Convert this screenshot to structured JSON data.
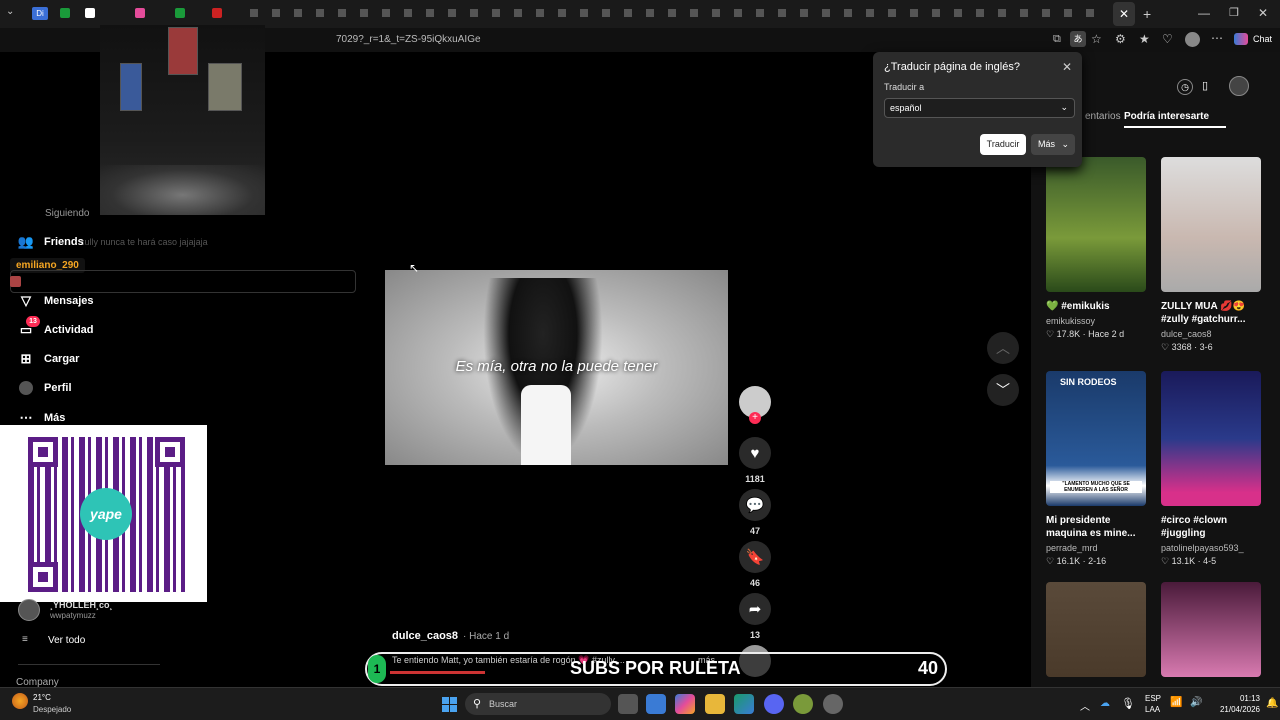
{
  "browser": {
    "url_fragment": "7029?_r=1&_t=ZS-95iQkxuAIGe",
    "chat_label": "Chat"
  },
  "translate_popup": {
    "title": "¿Traducir página de inglés?",
    "translate_to_label": "Traducir a",
    "language_value": "español",
    "translate_button": "Traducir",
    "more_button": "Más"
  },
  "overlay": {
    "chat_user": "emiliano_290",
    "chat_faded": "zully nunca te hará caso jajajaja",
    "following_faded": "Siguiendo",
    "subs_banner": "SUBS POR RULETA",
    "subs_count": "40",
    "subs_left_num": "1",
    "qr_brand": "yape"
  },
  "sidebar": {
    "items": [
      {
        "label": "Friends",
        "icon": "friends-icon"
      },
      {
        "label": "Mensajes",
        "icon": "messages-icon"
      },
      {
        "label": "Actividad",
        "icon": "activity-icon",
        "badge": "13"
      },
      {
        "label": "Cargar",
        "icon": "upload-icon"
      },
      {
        "label": "Perfil",
        "icon": "profile-icon"
      },
      {
        "label": "Más",
        "icon": "more-icon"
      }
    ],
    "following_user": "¸YHOLLEH¸co¸",
    "following_handle": "wwpatymuzz",
    "see_all": "Ver todo",
    "company": "Company"
  },
  "video": {
    "caption": "Es mía, otra no la puede tener",
    "author": "dulce_caos8",
    "time": "· Hace 1 d",
    "description": "Te entiendo Matt, yo también estaría de rogón 💗 #zully ...",
    "more": "más",
    "likes": "1181",
    "comments": "47",
    "saves": "46",
    "shares": "13"
  },
  "right_panel": {
    "tab_comments": "entarios",
    "tab_suggest": "Podría interesarte",
    "cards": [
      {
        "title": "💚 #emikukis",
        "user": "emikukissoy",
        "meta": "♡ 17.8K · Hace 2 d",
        "color": "#7a9a3a"
      },
      {
        "title": "ZULLY MUA 💋😍 #zully #gatchurr...",
        "user": "dulce_caos8",
        "meta": "♡ 3368 · 3-6",
        "color": "#c9b8b0"
      },
      {
        "title": "Mi presidente maquina es mine...",
        "user": "perrade_mrd",
        "meta": "♡ 16.1K · 2-16",
        "color": "#2a5a9a",
        "overlay_top": "SIN RODEOS",
        "overlay_bottom": "\"LAMENTO MUCHO QUE SE ENUMEREN A LAS SEÑOR"
      },
      {
        "title": "#circo #clown #juggling",
        "user": "patolinelpayaso593_",
        "meta": "♡ 13.1K · 4-5",
        "color": "#2a3a8a"
      },
      {
        "title": "",
        "user": "",
        "meta": "",
        "color": "#4a3a2a"
      },
      {
        "title": "",
        "user": "",
        "meta": "",
        "color": "#d87ab0"
      }
    ]
  },
  "taskbar": {
    "weather_temp": "21°C",
    "weather_desc": "Despejado",
    "search_placeholder": "Buscar",
    "lang": "ESP",
    "lang2": "LAA",
    "time": "01:13",
    "date": "21/04/2026"
  }
}
